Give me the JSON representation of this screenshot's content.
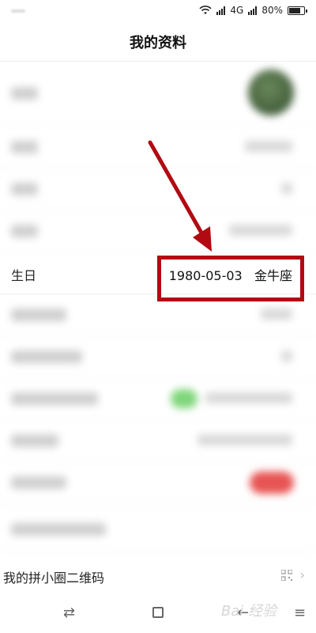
{
  "status_bar": {
    "network_label": "4G",
    "battery_percent": "80%",
    "battery_level": 0.8
  },
  "header": {
    "title": "我的资料"
  },
  "profile": {
    "birthday_row": {
      "label": "生日",
      "value": "1980-05-03",
      "zodiac": "金牛座"
    },
    "qrcode_row": {
      "label": "我的拼小圈二维码"
    }
  },
  "nav": {
    "back_icon": "swap-icon",
    "home_icon": "square-icon",
    "recent_icon": "back-arrow-icon"
  },
  "watermark": {
    "text": "Bai 经验"
  },
  "annotation": {
    "color": "#b10a12"
  }
}
